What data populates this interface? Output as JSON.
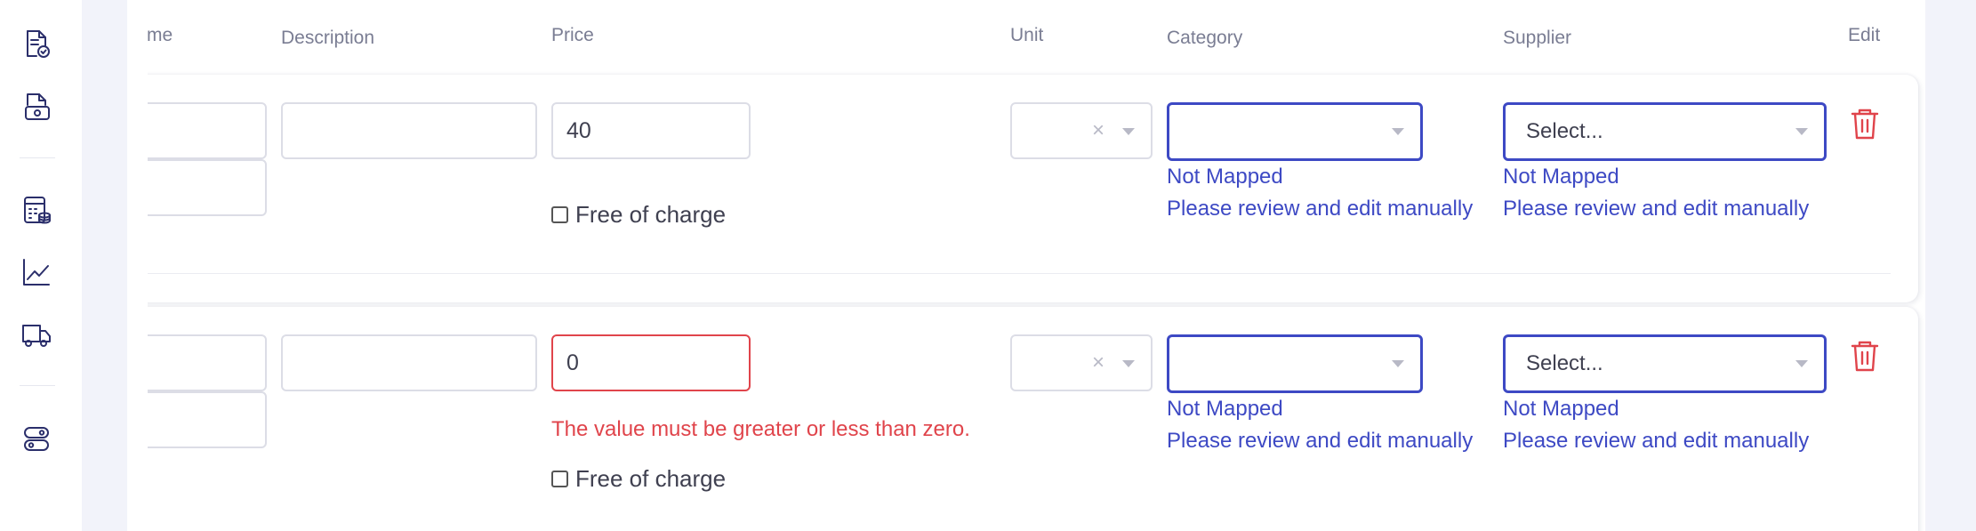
{
  "sidebar": {
    "icons": [
      "document-check-icon",
      "money-document-icon",
      "calculator-database-icon",
      "trend-chart-icon",
      "delivery-truck-icon",
      "toggle-switch-icon"
    ]
  },
  "table": {
    "headers": {
      "name": "me",
      "description": "Description",
      "price": "Price",
      "unit": "Unit",
      "category": "Category",
      "supplier": "Supplier",
      "edit": "Edit"
    },
    "rows": [
      {
        "price": "40",
        "price_error": "",
        "free_of_charge": "Free of charge",
        "unit_clear": "×",
        "category_status": "Not Mapped",
        "category_hint": "Please review and edit manually",
        "supplier_placeholder": "Select...",
        "supplier_status": "Not Mapped",
        "supplier_hint": "Please review and edit manually"
      },
      {
        "price": "0",
        "price_error": "The value must be greater or less than zero.",
        "free_of_charge": "Free of charge",
        "unit_clear": "×",
        "category_status": "Not Mapped",
        "category_hint": "Please review and edit manually",
        "supplier_placeholder": "Select...",
        "supplier_status": "Not Mapped",
        "supplier_hint": "Please review and edit manually"
      }
    ]
  },
  "colors": {
    "accent": "#3d49c4",
    "error": "#e0444b",
    "rail_icon": "#2b2f6b"
  }
}
